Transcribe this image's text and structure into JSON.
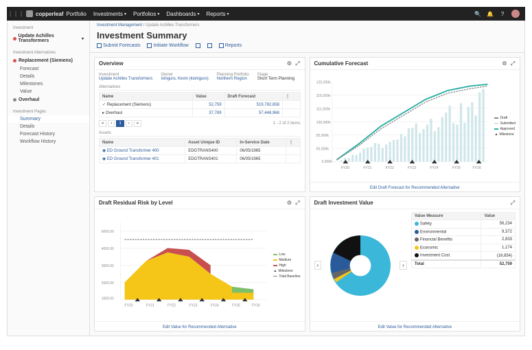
{
  "brand": {
    "name": "copperleaf",
    "product": "Portfolio"
  },
  "topnav": [
    "Investments",
    "Portfolios",
    "Dashboards",
    "Reports"
  ],
  "breadcrumb": {
    "a": "Investment Management",
    "b": "Update Achilles Transformers"
  },
  "page_title": "Investment Summary",
  "actions": {
    "submit": "Submit Forecasts",
    "initiate": "Initiate Workflow",
    "reports": "Reports"
  },
  "sidebar": {
    "group_investment": "Investment",
    "current": "Update Achilles Transformers",
    "group_alt": "Investment Alternatives",
    "alt1": "Replacement (Siemens)",
    "alt1_subs": [
      "Forecast",
      "Details",
      "Milestones",
      "Value"
    ],
    "alt2": "Overhaul",
    "group_pages": "Investment Pages",
    "pages": [
      "Summary",
      "Details",
      "Forecast History",
      "Workflow History"
    ]
  },
  "overview": {
    "title": "Overview",
    "cols": {
      "inv": "Investment",
      "own": "Owner",
      "pp": "Planning Portfolio",
      "stg": "Stage"
    },
    "vals": {
      "inv": "Update Achilles Transformers",
      "own": "Ishiguro, Kevin (kishiguro)",
      "pp": "Northern Region",
      "stg": "Short Term Planning"
    },
    "alt_label": "Alternatives",
    "alt_h": {
      "name": "Name",
      "val": "Value",
      "df": "Draft Forecast"
    },
    "alt_rows": [
      {
        "n": "Replacement (Siemens)",
        "v": "52,759",
        "d": "519,782,658"
      },
      {
        "n": "Overhaul",
        "v": "37,789",
        "d": "57,448,968"
      }
    ],
    "pager": "1 - 2 of 2 items",
    "assets_label": "Assets",
    "assets_h": {
      "n": "Name",
      "id": "Asset Unique ID",
      "d": "In-Service Date"
    },
    "assets_rows": [
      {
        "n": "ED Ground Transformer 400",
        "id": "EDGTRANS400",
        "d": "06/05/1965"
      },
      {
        "n": "ED Ground Transformer 401",
        "id": "EDGTRANS401",
        "d": "06/05/1965"
      }
    ]
  },
  "cumulative": {
    "title": "Cumulative Forecast",
    "legend": [
      "Draft",
      "Submitted",
      "Approved",
      "Milestone"
    ],
    "foot": "Edit Draft Forecast for Recommended Alternative"
  },
  "risk": {
    "title": "Draft Residual Risk by Level",
    "legend": [
      "Low",
      "Medium",
      "High",
      "Milestone",
      "Total Baseline"
    ],
    "foot": "Edit Value for Recommended Alternative"
  },
  "div": {
    "title": "Draft Investment Value",
    "h": {
      "vm": "Value Measure",
      "v": "Value"
    },
    "rows": [
      {
        "n": "Safety",
        "v": "56,234",
        "c": "#3bb8d9"
      },
      {
        "n": "Environmental",
        "v": "9,372",
        "c": "#2a5a9a"
      },
      {
        "n": "Financial Benefits",
        "v": "2,833",
        "c": "#666"
      },
      {
        "n": "Economic",
        "v": "1,174",
        "c": "#f5c518"
      },
      {
        "n": "Investment Cost",
        "v": "(16,854)",
        "c": "#111"
      }
    ],
    "total": {
      "l": "Total",
      "v": "52,759"
    },
    "foot": "Edit Value for Recommended Alternative"
  },
  "chart_data": [
    {
      "type": "area",
      "title": "Cumulative Forecast",
      "x": [
        "FY20",
        "FY21",
        "FY22",
        "FY23",
        "FY24",
        "FY25",
        "FY26"
      ],
      "series": [
        {
          "name": "Draft",
          "values": [
            5000,
            30000,
            60000,
            80000,
            100000,
            115000,
            120000
          ]
        },
        {
          "name": "Submitted",
          "values": [
            4000,
            28000,
            55000,
            75000,
            95000,
            110000,
            118000
          ]
        },
        {
          "name": "Approved",
          "values": [
            3500,
            25000,
            50000,
            70000,
            90000,
            105000,
            115000
          ]
        }
      ],
      "ylim": [
        0,
        120000
      ],
      "milestones": [
        "FY20",
        "FY21",
        "FY22",
        "FY23",
        "FY24",
        "FY25",
        "FY26"
      ]
    },
    {
      "type": "bar",
      "title": "Draft Residual Risk by Level",
      "x": [
        "FY20",
        "FY21",
        "FY22",
        "FY23",
        "FY24",
        "FY25",
        "FY26"
      ],
      "series": [
        {
          "name": "Low",
          "values": [
            0,
            0,
            0,
            0,
            0,
            500,
            500
          ]
        },
        {
          "name": "Medium",
          "values": [
            2000,
            3500,
            4000,
            3500,
            2000,
            1000,
            500
          ]
        },
        {
          "name": "High",
          "values": [
            0,
            1000,
            2000,
            1500,
            1000,
            500,
            0
          ]
        },
        {
          "name": "Total Baseline",
          "values": [
            6000,
            6000,
            6000,
            6000,
            6000,
            6000,
            6000
          ]
        }
      ],
      "ylim": [
        0,
        8000
      ]
    },
    {
      "type": "pie",
      "title": "Draft Investment Value",
      "series": [
        {
          "name": "Safety",
          "value": 56234
        },
        {
          "name": "Environmental",
          "value": 9372
        },
        {
          "name": "Financial Benefits",
          "value": 2833
        },
        {
          "name": "Economic",
          "value": 1174
        },
        {
          "name": "Investment Cost",
          "value": 16854
        }
      ]
    }
  ]
}
